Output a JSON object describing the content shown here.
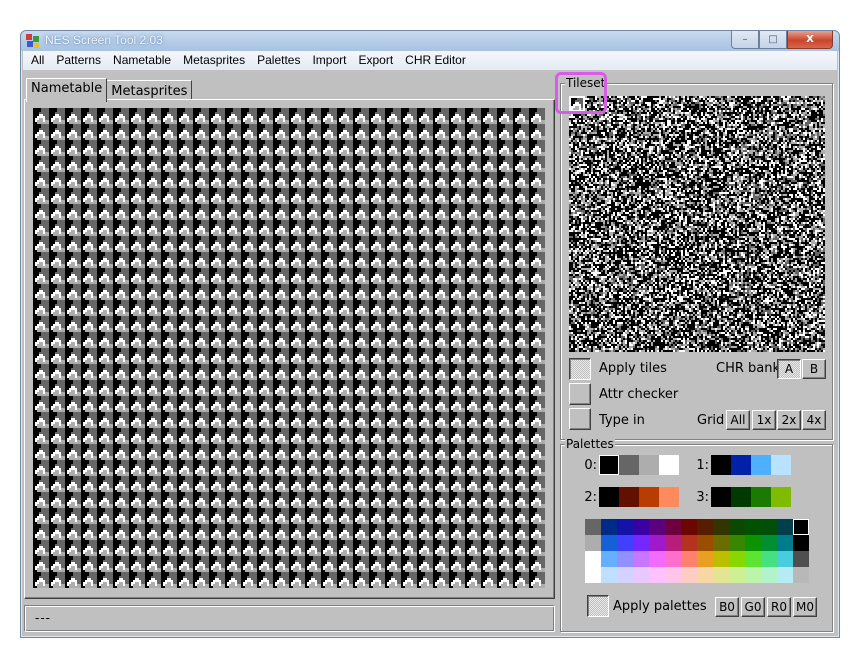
{
  "window": {
    "title": "NES Screen Tool 2.03",
    "controls": {
      "minimize": "–",
      "maximize": "□",
      "close": "X"
    }
  },
  "menu": [
    "All",
    "Patterns",
    "Nametable",
    "Metasprites",
    "Palettes",
    "Import",
    "Export",
    "CHR Editor"
  ],
  "tabs": [
    {
      "label": "Nametable",
      "active": true
    },
    {
      "label": "Metasprites",
      "active": false
    }
  ],
  "nametable": {
    "columns": 32,
    "rows": 30,
    "tile_index": 0
  },
  "status": {
    "text": "---"
  },
  "tileset": {
    "group_label": "Tileset",
    "selected_tile": 0,
    "apply_tiles": {
      "label": "Apply tiles",
      "checked": true
    },
    "attr_checker": {
      "label": "Attr checker",
      "checked": false
    },
    "type_in": {
      "label": "Type in",
      "checked": false
    },
    "chr_bank": {
      "label": "CHR bank",
      "options": [
        "A",
        "B"
      ],
      "selected": "A"
    },
    "grid": {
      "label": "Grid",
      "options": [
        "All",
        "1x",
        "2x",
        "4x"
      ]
    }
  },
  "palettes": {
    "group_label": "Palettes",
    "sets": [
      {
        "label": "0:",
        "colors": [
          "#000000",
          "#666666",
          "#adadad",
          "#ffffff"
        ],
        "selected_index": 0
      },
      {
        "label": "1:",
        "colors": [
          "#000000",
          "#0021a8",
          "#4fb0ff",
          "#b8e2fe"
        ]
      },
      {
        "label": "2:",
        "colors": [
          "#000000",
          "#621100",
          "#b93c00",
          "#ff8a5e"
        ]
      },
      {
        "label": "3:",
        "colors": [
          "#000000",
          "#003a00",
          "#1b7a00",
          "#7fbc00"
        ]
      }
    ],
    "nes_palette": [
      [
        "#666666",
        "#002a88",
        "#1412a7",
        "#3b00a4",
        "#5c007e",
        "#6e0040",
        "#6c0600",
        "#561d00",
        "#333500",
        "#0b4800",
        "#005200",
        "#004f08",
        "#00404d",
        "#000000"
      ],
      [
        "#adadad",
        "#155fd9",
        "#4240ff",
        "#7527fe",
        "#a01acc",
        "#b71e7b",
        "#b53120",
        "#994e00",
        "#6b6d00",
        "#388700",
        "#0c9300",
        "#008f32",
        "#007c8d",
        "#000000"
      ],
      [
        "#ffffff",
        "#64b0ff",
        "#9290ff",
        "#c676ff",
        "#f36aff",
        "#fe6ecc",
        "#fe8170",
        "#ea9e22",
        "#bcbe00",
        "#88d800",
        "#5ce430",
        "#45e082",
        "#48cdde",
        "#4f4f4f"
      ],
      [
        "#ffffff",
        "#c0dfff",
        "#d3d2ff",
        "#e8c8ff",
        "#fbc2ff",
        "#fec4ea",
        "#feccc5",
        "#f7d8a5",
        "#e4e594",
        "#cfef96",
        "#bdf4ab",
        "#b3f3cc",
        "#b5ebf2",
        "#b8b8b8"
      ]
    ],
    "nes_selected": [
      0,
      13
    ],
    "apply_palettes": {
      "label": "Apply palettes",
      "checked": true
    },
    "buttons": [
      "B0",
      "G0",
      "R0",
      "M0"
    ]
  }
}
